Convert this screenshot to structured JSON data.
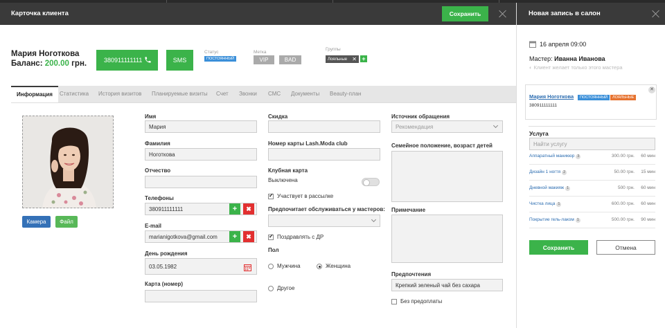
{
  "client_card": {
    "title": "Карточка клиента",
    "save_label": "Сохранить",
    "name": "Мария Ноготкова",
    "balance_label": "Баланс:",
    "balance_value": "200.00",
    "balance_currency": "грн.",
    "phone": "380911111111",
    "sms_label": "SMS",
    "status_label": "Статус",
    "status_value": "ПОСТОЯННЫЙ",
    "mark_label": "Метка",
    "mark_vip": "VIP",
    "mark_bad": "BAD",
    "groups_label": "Группы",
    "group_chip": "Лояльные",
    "group_chip_remove": "✕",
    "group_add": "+"
  },
  "tabs": [
    {
      "label": "Информация",
      "active": true
    },
    {
      "label": "Статистика"
    },
    {
      "label": "История визитов"
    },
    {
      "label": "Планируемые визиты"
    },
    {
      "label": "Счет"
    },
    {
      "label": "Звонки"
    },
    {
      "label": "СМС"
    },
    {
      "label": "Документы"
    },
    {
      "label": "Beauty-план"
    }
  ],
  "photo": {
    "camera_label": "Камера",
    "file_label": "Файл"
  },
  "form": {
    "first_name_label": "Имя",
    "first_name": "Мария",
    "last_name_label": "Фамилия",
    "last_name": "Ноготкова",
    "patronymic_label": "Отчество",
    "patronymic": "",
    "phones_label": "Телефоны",
    "phone": "380911111111",
    "email_label": "E-mail",
    "email": "marianigotkova@gmail.com",
    "birthday_label": "День рождения",
    "birthday": "03.05.1982",
    "card_label": "Карта (номер)",
    "card": "",
    "add_symbol": "+",
    "remove_symbol": "✖",
    "discount_label": "Скидка",
    "discount": "",
    "club_card_number_label": "Номер карты Lash.Moda club",
    "club_card_number": "",
    "club_card_label": "Клубная карта",
    "club_card_state": "Выключена",
    "mailing_label": "Участвует в рассылке",
    "mailing_checked": true,
    "prefer_masters_label": "Предпочитает обслуживаться у мастеров:",
    "prefer_masters_value": "",
    "congratulate_label": "Поздравлять с ДР",
    "congratulate_checked": true,
    "gender_label": "Пол",
    "gender_male": "Мужчина",
    "gender_female": "Женщина",
    "gender_other": "Другое",
    "gender_selected": "Женщина",
    "source_label": "Источник обращения",
    "source_value": "Рекомендация",
    "family_label": "Семейное положение, возраст детей",
    "note_label": "Примечание",
    "preferences_label": "Предпочтения",
    "preferences_value": "Крепкий зеленый чай без сахара",
    "no_prepay_label": "Без предоплаты",
    "no_prepay_checked": false
  },
  "booking": {
    "title": "Новая запись в салон",
    "date": "16 апреля 09:00",
    "master_label": "Мастер:",
    "master_name": "Иванна Иванова",
    "master_hint": "Клиент желает только этого мастера",
    "client_name": "Мария Ноготкова",
    "client_status": "ПОСТОЯННЫЙ",
    "client_group": "ЛОЯЛЬНЫЕ",
    "client_phone": "380911111111",
    "client_close": "✕",
    "service_label": "Услуга",
    "service_search_placeholder": "Найти услугу",
    "services": [
      {
        "name": "Аппаратный маникюр",
        "count": "3",
        "price": "300.00 грн.",
        "duration": "60 мин"
      },
      {
        "name": "Дизайн 1 ногтя",
        "count": "2",
        "price": "50.00 грн.",
        "duration": "15 мин"
      },
      {
        "name": "Дневной макияж",
        "count": "1",
        "price": "500 грн.",
        "duration": "60 мин"
      },
      {
        "name": "Чистка лица",
        "count": "1",
        "price": "600.00 грн.",
        "duration": "60 мин"
      },
      {
        "name": "Покрытие гель-лаком",
        "count": "1",
        "price": "500.00 грн.",
        "duration": "90 мин"
      }
    ],
    "save_label": "Сохранить",
    "cancel_label": "Отмена"
  },
  "colors": {
    "accent_green": "#3bb34a",
    "header_dark": "#3a3a3a",
    "link_blue": "#2b6cb0",
    "danger_red": "#e23030"
  }
}
